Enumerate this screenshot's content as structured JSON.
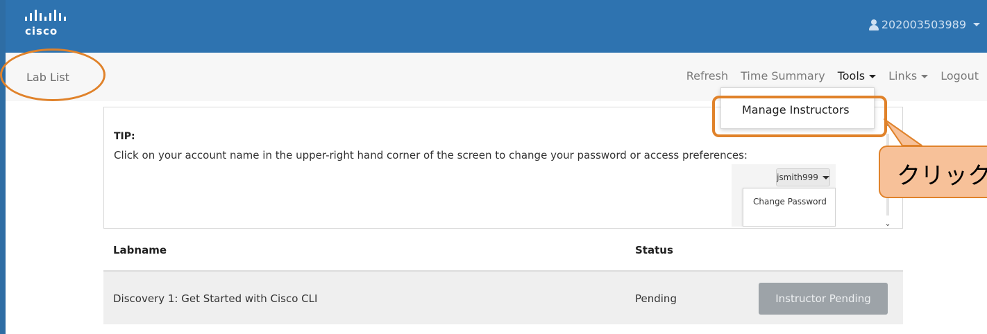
{
  "header": {
    "logo_word": "cisco",
    "user_account": "202003503989",
    "brand_color": "#2e73b0"
  },
  "nav": {
    "lab_list": "Lab List",
    "links": [
      {
        "label": "Refresh",
        "active": false,
        "has_caret": false
      },
      {
        "label": "Time Summary",
        "active": false,
        "has_caret": false
      },
      {
        "label": "Tools",
        "active": true,
        "has_caret": true
      },
      {
        "label": "Links",
        "active": false,
        "has_caret": true
      },
      {
        "label": "Logout",
        "active": false,
        "has_caret": false
      }
    ]
  },
  "tools_menu": {
    "items": [
      "Manage Instructors"
    ]
  },
  "tip": {
    "title": "TIP:",
    "text": "Click on your account name in the upper-right hand corner of the screen to change your password or access preferences:",
    "preview_user": "jsmith999",
    "preview_item": "Change Password"
  },
  "table": {
    "headers": {
      "labname": "Labname",
      "status": "Status"
    },
    "rows": [
      {
        "labname": "Discovery 1: Get Started with Cisco CLI",
        "status": "Pending",
        "action": "Instructor Pending"
      }
    ]
  },
  "annotation": {
    "callout_text": "クリック",
    "accent_color": "#e0822a"
  }
}
